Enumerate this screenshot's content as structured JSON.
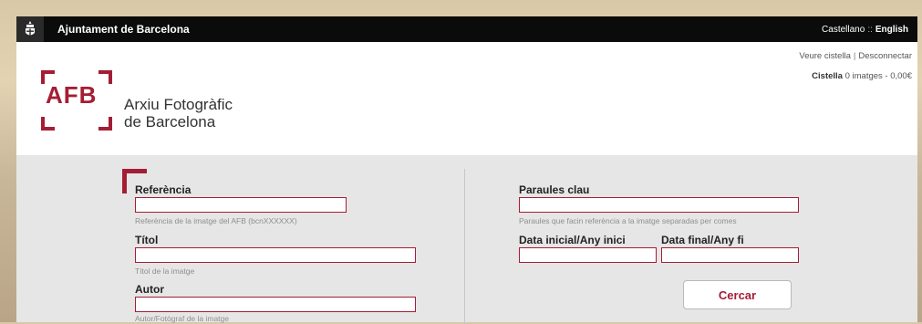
{
  "topbar": {
    "brand": "Ajuntament de Barcelona",
    "lang_castellano": "Castellano",
    "lang_separator": "::",
    "lang_english": "English"
  },
  "header": {
    "logo_text": "AFB",
    "name_line1": "Arxiu Fotogràfic",
    "name_line2": "de Barcelona",
    "view_cart": "Veure cistella",
    "links_separator": "|",
    "disconnect": "Desconnectar",
    "cart_label": "Cistella",
    "cart_info": "0 imatges - 0,00€"
  },
  "form": {
    "referencia": {
      "label": "Referència",
      "value": "",
      "hint": "Referència de la imatge del AFB (bcnXXXXXX)"
    },
    "titol": {
      "label": "Títol",
      "value": "",
      "hint": "Títol de la imatge"
    },
    "autor": {
      "label": "Autor",
      "value": "",
      "hint": "Autor/Fotògraf de la imatge"
    },
    "paraules": {
      "label": "Paraules clau",
      "value": "",
      "hint": "Paraules que facin referència a la imatge separadas per comes"
    },
    "data_inicial": {
      "label": "Data inicial/Any inici",
      "value": ""
    },
    "data_final": {
      "label": "Data final/Any fi",
      "value": ""
    },
    "search_button": "Cercar"
  },
  "colors": {
    "accent": "#a51d34",
    "topbar": "#0b0b0b",
    "form_bg": "#e6e6e6"
  },
  "icons": {
    "seal": "barcelona-seal-icon"
  }
}
